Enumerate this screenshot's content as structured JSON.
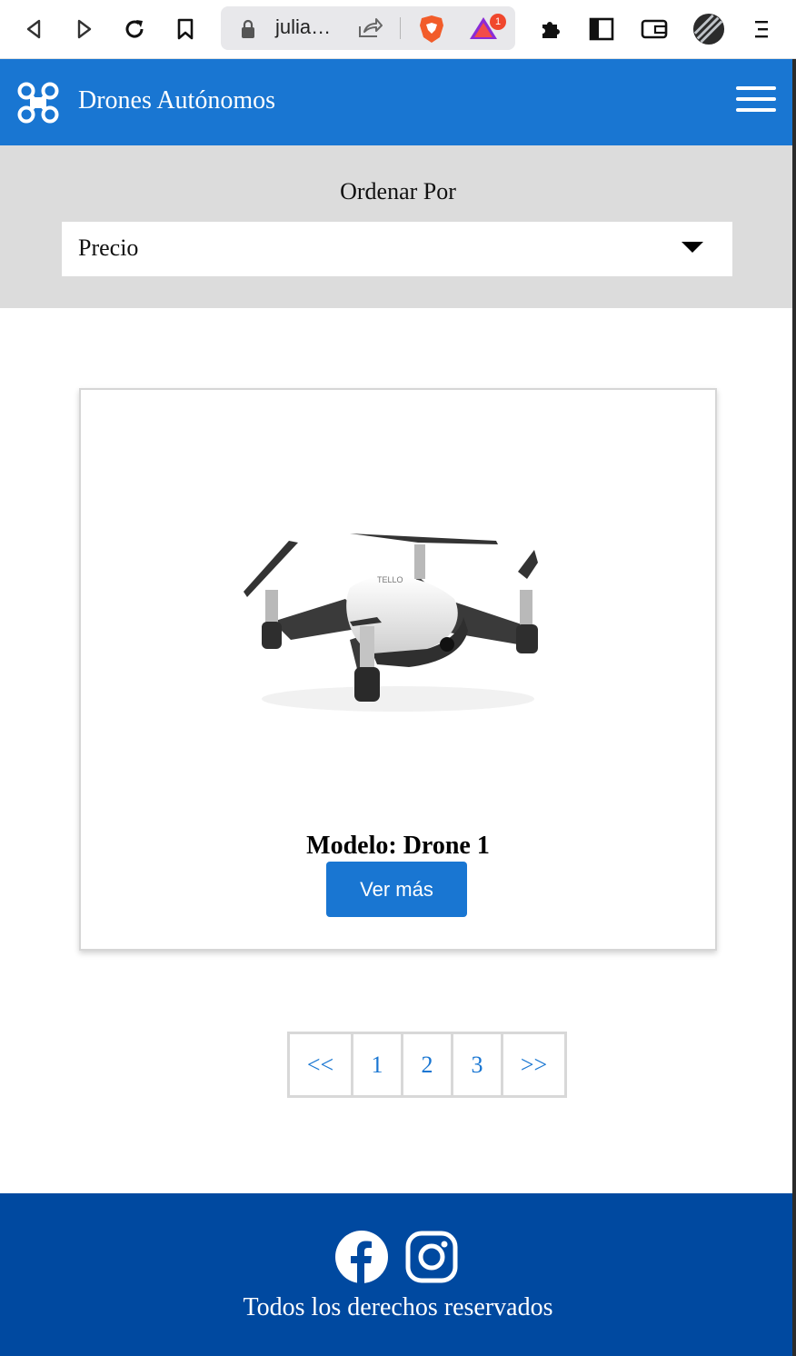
{
  "browser": {
    "url": "julia…",
    "rewards_badge": "1"
  },
  "header": {
    "brand": "Drones Autónomos"
  },
  "sort": {
    "label": "Ordenar Por",
    "selected": "Precio"
  },
  "card": {
    "title": "Modelo: Drone 1",
    "button": "Ver más"
  },
  "pagination": {
    "prev": "<<",
    "pages": [
      "1",
      "2",
      "3"
    ],
    "next": ">>"
  },
  "footer": {
    "copyright": "Todos los derechos reservados"
  },
  "colors": {
    "primary": "#1976d2",
    "footer": "#0049a0",
    "sort_bg": "#dcdcdc"
  }
}
